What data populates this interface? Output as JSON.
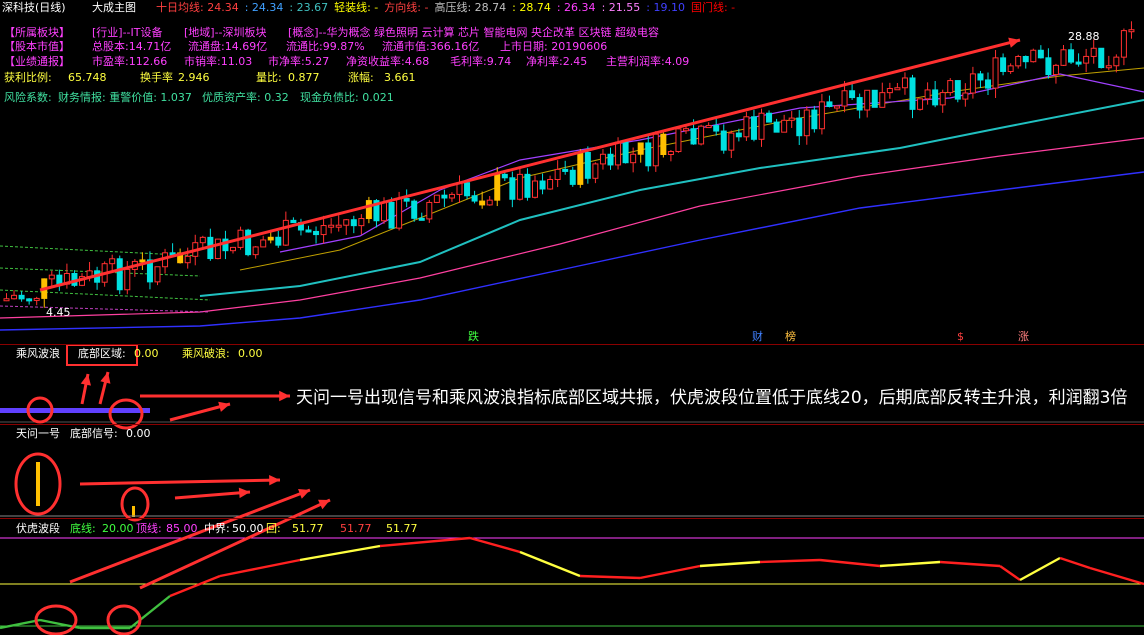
{
  "header": {
    "stock_name": "深科技(日线)",
    "main_chart": "大成主图",
    "indicators": [
      {
        "label": "十日均线",
        "value": "24.34",
        "color": "#ff4040"
      },
      {
        "label": "",
        "value": "24.34",
        "color": "#40a0ff"
      },
      {
        "label": "",
        "value": "23.67",
        "color": "#40c0c0"
      },
      {
        "label": "轻装线",
        "value": "-",
        "color": "#ffff00"
      },
      {
        "label": "方向线",
        "value": "-",
        "color": "#ff4040"
      },
      {
        "label": "高压线",
        "value": "28.74",
        "color": "#c0c0c0"
      },
      {
        "label": "",
        "value": "28.74",
        "color": "#ffff00"
      },
      {
        "label": "",
        "value": "26.34",
        "color": "#ff40ff"
      },
      {
        "label": "",
        "value": "21.55",
        "color": "#ff80ff"
      },
      {
        "label": "",
        "value": "19.10",
        "color": "#4040ff"
      },
      {
        "label": "国门线",
        "value": "-",
        "color": "#ff0000"
      }
    ]
  },
  "info": {
    "row1": {
      "label": "【所属板块】",
      "items": [
        "[行业]--IT设备",
        "[地域]--深圳板块",
        "[概念]--华为概念 绿色照明 云计算 芯片 智能电网 央企改革 区块链 超级电容"
      ]
    },
    "row2": {
      "label": "【股本市值】",
      "items": [
        "总股本:14.71亿",
        "流通盘:14.69亿",
        "流通比:99.87%",
        "流通市值:366.16亿",
        "上市日期: 20190606"
      ]
    },
    "row3": {
      "label": "【业绩通报】",
      "items": [
        "市盈率:112.66",
        "市销率:11.03",
        "市净率:5.27",
        "净资收益率:4.68",
        "毛利率:9.74",
        "净利率:2.45",
        "主营利润率:4.09"
      ]
    },
    "row4": {
      "items": [
        {
          "label": "获利比例:",
          "value": "65.748"
        },
        {
          "label": "换手率",
          "value": "2.946"
        },
        {
          "label": "量比:",
          "value": "0.877"
        },
        {
          "label": "涨幅:",
          "value": "3.661"
        }
      ]
    },
    "row5": {
      "label": "风险系数:",
      "items": [
        "财务情报: 重警价值: 1.037",
        "优质资产率: 0.32",
        "现金负债比: 0.021"
      ]
    }
  },
  "price_labels": {
    "high": "28.88",
    "low": "4.45"
  },
  "markers": [
    "跌",
    "财",
    "榜",
    "$",
    "涨"
  ],
  "pane1": {
    "name": "乘风波浪",
    "items": [
      {
        "label": "底部区域:",
        "value": "0.00"
      },
      {
        "label": "乘风破浪:",
        "value": "0.00"
      }
    ]
  },
  "pane2": {
    "name": "天问一号",
    "items": [
      {
        "label": "底部信号:",
        "value": "0.00"
      }
    ]
  },
  "pane3": {
    "name": "伏虎波段",
    "items": [
      {
        "label": "底线:",
        "value": "20.00"
      },
      {
        "label": "顶线:",
        "value": "85.00"
      },
      {
        "label": "中界:",
        "value": "50.00"
      },
      {
        "label": "回:",
        "value": "51.77"
      },
      {
        "label": "",
        "value": "51.77"
      },
      {
        "label": "",
        "value": "51.77"
      }
    ]
  },
  "annotation": "天问一号出现信号和乘风波浪指标底部区域共振，伏虎波段位置低于底线20，后期底部反转主升浪，利润翻3倍",
  "colors": {
    "background": "#000000",
    "separator": "#8a0000",
    "up": "#ff3030",
    "down": "#00e0e0",
    "gold": "#ffc000",
    "annotation_arrow": "#ff3030"
  }
}
